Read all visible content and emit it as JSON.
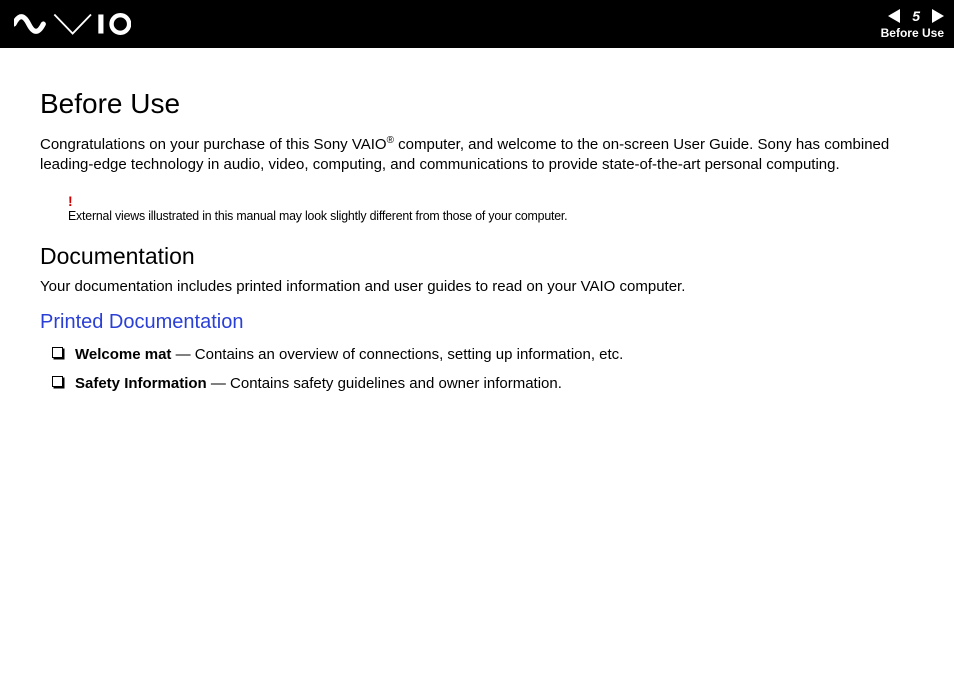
{
  "header": {
    "page_number": "5",
    "section": "Before Use"
  },
  "page_title": "Before Use",
  "intro_pre": "Congratulations on your purchase of this Sony VAIO",
  "intro_sup": "®",
  "intro_post": " computer, and welcome to the on-screen User Guide. Sony has combined leading-edge technology in audio, video, computing, and communications to provide state-of-the-art personal computing.",
  "excl": "!",
  "note": "External views illustrated in this manual may look slightly different from those of your computer.",
  "h2_documentation": "Documentation",
  "doc_intro": "Your documentation includes printed information and user guides to read on your VAIO computer.",
  "h3_printed": "Printed Documentation",
  "bullets": [
    {
      "label": "Welcome mat",
      "desc": " — Contains an overview of connections, setting up information, etc."
    },
    {
      "label": "Safety Information",
      "desc": " — Contains safety guidelines and owner information."
    }
  ]
}
